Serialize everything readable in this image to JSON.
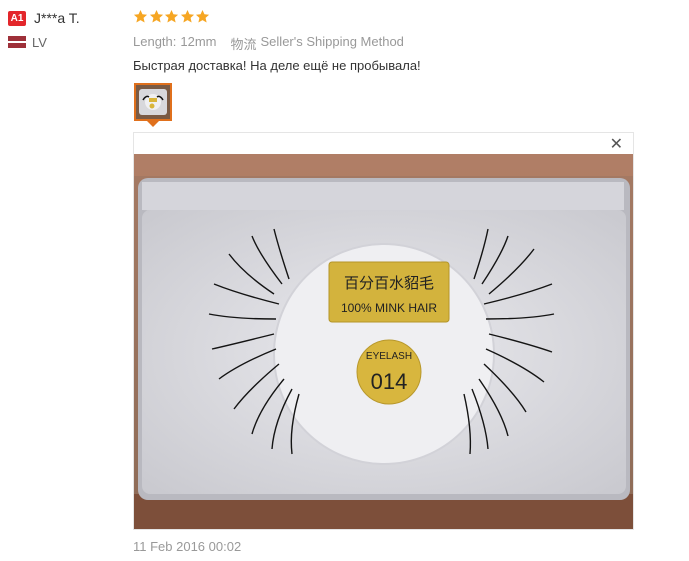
{
  "reviewer": {
    "level": "A1",
    "name": "J***a T.",
    "country": "LV"
  },
  "review": {
    "rating": 5,
    "length_label": "Length:",
    "length_value": "12mm",
    "shipping_label": "物流",
    "shipping_value": "Seller's Shipping Method",
    "text": "Быстрая доставка! На деле ещё не пробывала!",
    "date": "11 Feb 2016 00:02"
  },
  "photo": {
    "label_cn": "百分百水貂毛",
    "label_en": "100% MINK HAIR",
    "sticker_top": "EYELASH",
    "sticker_num": "014"
  },
  "colors": {
    "star": "#f6a623",
    "badge": "#e3262b",
    "thumb_border": "#e0701c"
  },
  "icons": {
    "close": "close-icon",
    "star": "star-icon",
    "flag": "latvia-flag-icon"
  }
}
